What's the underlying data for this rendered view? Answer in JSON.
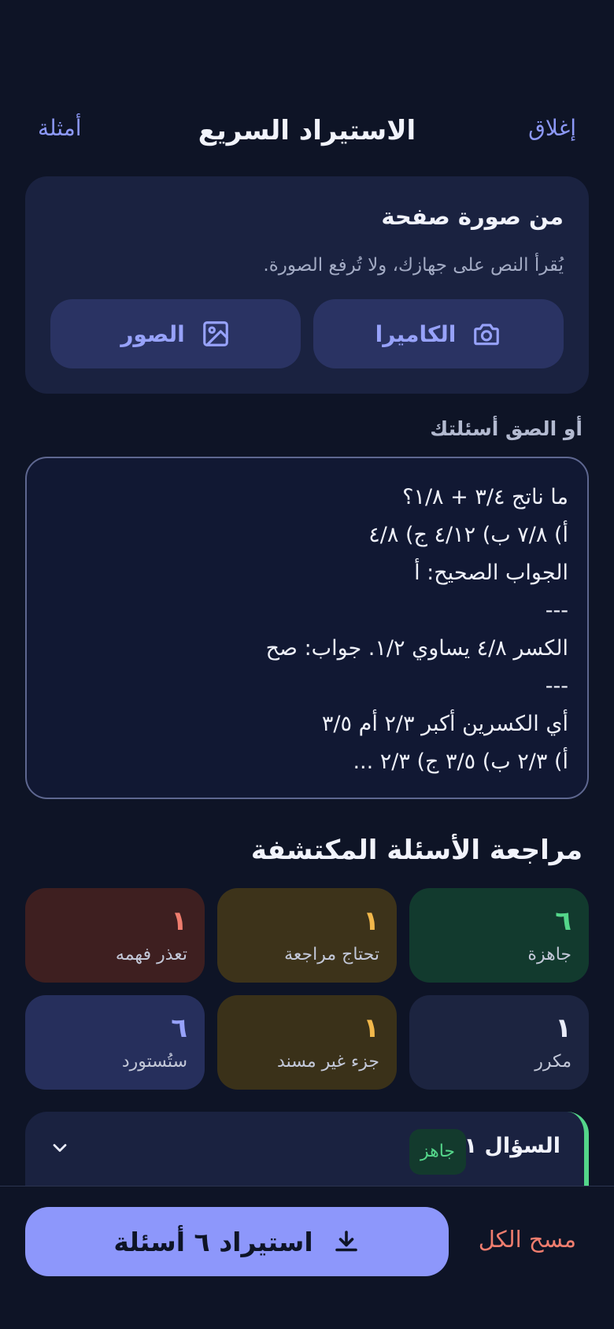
{
  "header": {
    "close_label": "إغلاق",
    "title": "الاستيراد السريع",
    "examples_label": "أمثلة"
  },
  "photo_card": {
    "title": "من صورة صفحة",
    "subtitle": "يُقرأ النص على جهازك، ولا تُرفع الصورة.",
    "camera_label": "الكاميرا",
    "photos_label": "الصور",
    "camera_icon": "camera-icon",
    "photos_icon": "image-icon"
  },
  "paste": {
    "label": "أو الصق أسئلتك",
    "lines": [
      "ما ناتج ٣/٤ + ١/٨؟",
      "أ) ٧/٨ ب) ٤/١٢ ج) ٤/٨",
      "الجواب الصحيح: أ",
      "---",
      "الكسر ٤/٨ يساوي ١/٢. جواب: صح",
      "---",
      "أي الكسرين أكبر ٢/٣ أم ٣/٥",
      "أ) ٢/٣ ب) ٣/٥ ج) ٢/٣ ..."
    ]
  },
  "review": {
    "title": "مراجعة الأسئلة المكتشفة",
    "stats": {
      "ready": {
        "count": "٦",
        "label": "جاهزة"
      },
      "needs_review": {
        "count": "١",
        "label": "تحتاج مراجعة"
      },
      "failed": {
        "count": "١",
        "label": "تعذر فهمه"
      },
      "duplicate": {
        "count": "١",
        "label": "مكرر"
      },
      "partial": {
        "count": "١",
        "label": "جزء غير مسند"
      },
      "standard": {
        "count": "٦",
        "label": "ستُستورد"
      }
    }
  },
  "question": {
    "label": "السؤال ١",
    "status": "جاهز"
  },
  "bottom": {
    "import_label": "استيراد ٦ أسئلة",
    "clear_label": "مسح الكل"
  },
  "colors": {
    "accent": "#8d97fb",
    "ready": "#54d68a",
    "warning": "#f2b84b",
    "danger": "#ef7d6e",
    "background": "#0e1426"
  }
}
